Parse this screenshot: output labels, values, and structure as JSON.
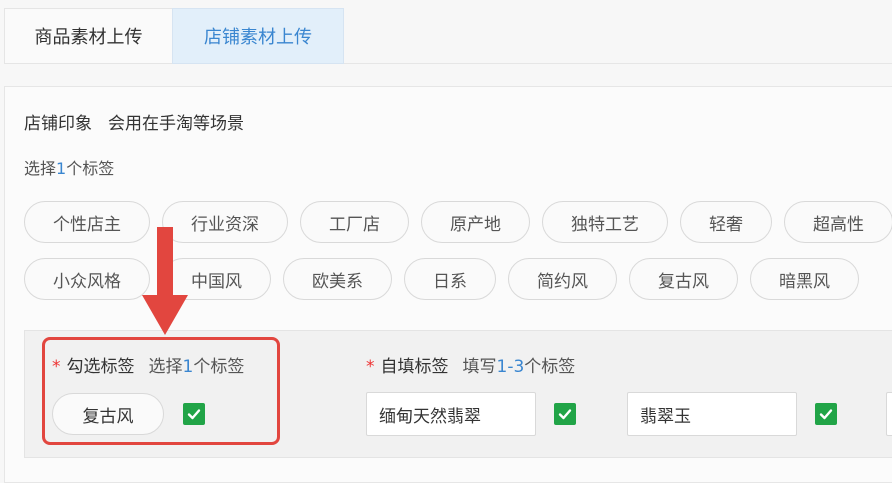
{
  "tabs": [
    {
      "label": "商品素材上传",
      "active": false
    },
    {
      "label": "店铺素材上传",
      "active": true
    }
  ],
  "section": {
    "title": "店铺印象",
    "description": "会用在手淘等场景",
    "hint_prefix": "选择",
    "hint_num": "1",
    "hint_suffix": "个标签"
  },
  "tags_row1": [
    "个性店主",
    "行业资深",
    "工厂店",
    "原产地",
    "独特工艺",
    "轻奢",
    "超高性"
  ],
  "tags_row2": [
    "小众风格",
    "中国风",
    "欧美系",
    "日系",
    "简约风",
    "复古风",
    "暗黑风"
  ],
  "selected": {
    "star": "*",
    "label": "勾选标签",
    "hint_prefix": "选择",
    "hint_num": "1",
    "hint_suffix": "个标签",
    "tag": "复古风"
  },
  "custom": {
    "star": "*",
    "label": "自填标签",
    "hint_prefix": "填写",
    "hint_num": "1-3",
    "hint_suffix": "个标签",
    "inputs": [
      "缅甸天然翡翠",
      "翡翠玉",
      ""
    ]
  },
  "colors": {
    "accent": "#3a86d0",
    "check": "#21a447",
    "annotation": "#e2463f"
  },
  "icons": [
    "checkmark-icon",
    "down-arrow-icon"
  ]
}
